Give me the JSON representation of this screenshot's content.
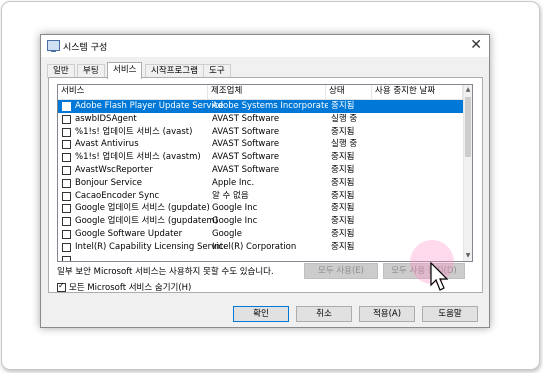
{
  "dialog": {
    "title": "시스템 구성",
    "close_glyph": "✕"
  },
  "tabs": [
    "일반",
    "부팅",
    "서비스",
    "시작프로그램",
    "도구"
  ],
  "active_tab": "서비스",
  "columns": [
    "서비스",
    "제조업체",
    "상태",
    "사용 중지한 날짜"
  ],
  "services": [
    {
      "name": "Adobe Flash Player Update Service",
      "manufacturer": "Adobe Systems Incorporated",
      "status": "중지됨",
      "selected": true
    },
    {
      "name": "aswbIDSAgent",
      "manufacturer": "AVAST Software",
      "status": "실행 중"
    },
    {
      "name": "%1!s! 업데이트 서비스 (avast)",
      "manufacturer": "AVAST Software",
      "status": "중지됨"
    },
    {
      "name": "Avast Antivirus",
      "manufacturer": "AVAST Software",
      "status": "실행 중"
    },
    {
      "name": "%1!s! 업데이트 서비스 (avastm)",
      "manufacturer": "AVAST Software",
      "status": "중지됨"
    },
    {
      "name": "AvastWscReporter",
      "manufacturer": "AVAST Software",
      "status": "중지됨"
    },
    {
      "name": "Bonjour Service",
      "manufacturer": "Apple Inc.",
      "status": "중지됨"
    },
    {
      "name": "CacaoEncoder Sync",
      "manufacturer": "알 수 없음",
      "status": "중지됨"
    },
    {
      "name": "Google 업데이트 서비스 (gupdate)",
      "manufacturer": "Google Inc",
      "status": "중지됨"
    },
    {
      "name": "Google 업데이트 서비스 (gupdatem)",
      "manufacturer": "Google Inc",
      "status": "중지됨"
    },
    {
      "name": "Google Software Updater",
      "manufacturer": "Google",
      "status": "중지됨"
    },
    {
      "name": "Intel(R) Capability Licensing Service...",
      "manufacturer": "Intel(R) Corporation",
      "status": "중지됨"
    },
    {
      "name": "",
      "manufacturer": "",
      "status": ""
    }
  ],
  "note_text": "일부 보안 Microsoft 서비스는 사용하지 못할 수도 있습니다.",
  "buttons": {
    "enable_all": "모두 사용(E)",
    "disable_all": "모두 사용 중지(D)",
    "hide_ms": "모든 Microsoft 서비스 숨기기(H)",
    "ok": "확인",
    "cancel": "취소",
    "apply": "적용(A)",
    "help": "도움말"
  },
  "colors": {
    "selection": "#0078d7",
    "dialog_bg": "#f0f0f0",
    "cursor_halo": "#ff96c8"
  }
}
